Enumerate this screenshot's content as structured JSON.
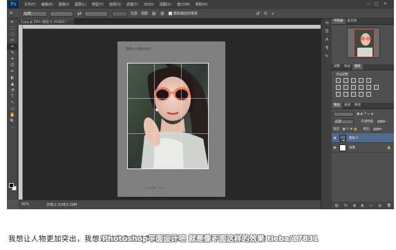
{
  "app": {
    "logo": "Ps",
    "menu": [
      "文件(F)",
      "编辑(E)",
      "图像(I)",
      "图层(L)",
      "类型(Y)",
      "选择(S)",
      "滤镜(T)",
      "3D(D)",
      "视图(V)",
      "窗口(W)",
      "帮助(H)"
    ],
    "window_controls": [
      "—",
      "□",
      "✕"
    ]
  },
  "options_bar": {
    "ratio_value": "比例",
    "straighten_label": "拉直",
    "view_label": "视图",
    "delete_pixels_label": "删除裁剪的像素",
    "reset_icon": "reset-icon",
    "cancel_icon": "cancel-icon",
    "commit_icon": "commit-icon"
  },
  "document": {
    "tab_title": "3.jpg @ 50% (图层 0, RGB/8) *",
    "artboard_header": "我想让人物更加突出",
    "artboard_footer": "RGB 图像 · 50%",
    "zoom": "50%",
    "doc_info": "文档:2.31M/2.29M"
  },
  "tools": [
    "▸",
    "⬚",
    "◌",
    "✂",
    "⌗",
    "✎",
    "✦",
    "⎚",
    "✏",
    "◐",
    "▲",
    "◔",
    "T",
    "↖",
    "▭",
    "✋",
    "🔍",
    "⋯"
  ],
  "panels": {
    "navigator_tabs": [
      "导航器",
      "直方图"
    ],
    "adjust_tabs": [
      "调整",
      "样式",
      "属性"
    ],
    "adjust_title": "添加调整",
    "layers_tabs": [
      "图层",
      "通道",
      "路径"
    ],
    "blend_mode": "正常",
    "opacity_label": "不透明度:",
    "opacity_value": "100%",
    "lock_label": "锁定:",
    "fill_label": "填充:",
    "fill_value": "100%",
    "layers": [
      {
        "name": "图层 0",
        "selected": true
      },
      {
        "name": "背景",
        "selected": false
      }
    ],
    "footer_icons": [
      "⛓",
      "fx",
      "◑",
      "◐",
      "▭",
      "▤",
      "🗑"
    ]
  },
  "caption": {
    "text": "我想让人物更加突出，我想通过调色来达到这个效果，就是像下面这样的效果"
  },
  "watermark": {
    "text": "Photoshop平面设计吧 就是像下面这样的效果 tieba/17831"
  },
  "colors": {
    "accent_lenses": "#f07a5e",
    "selected_layer": "#4e6b8f"
  }
}
